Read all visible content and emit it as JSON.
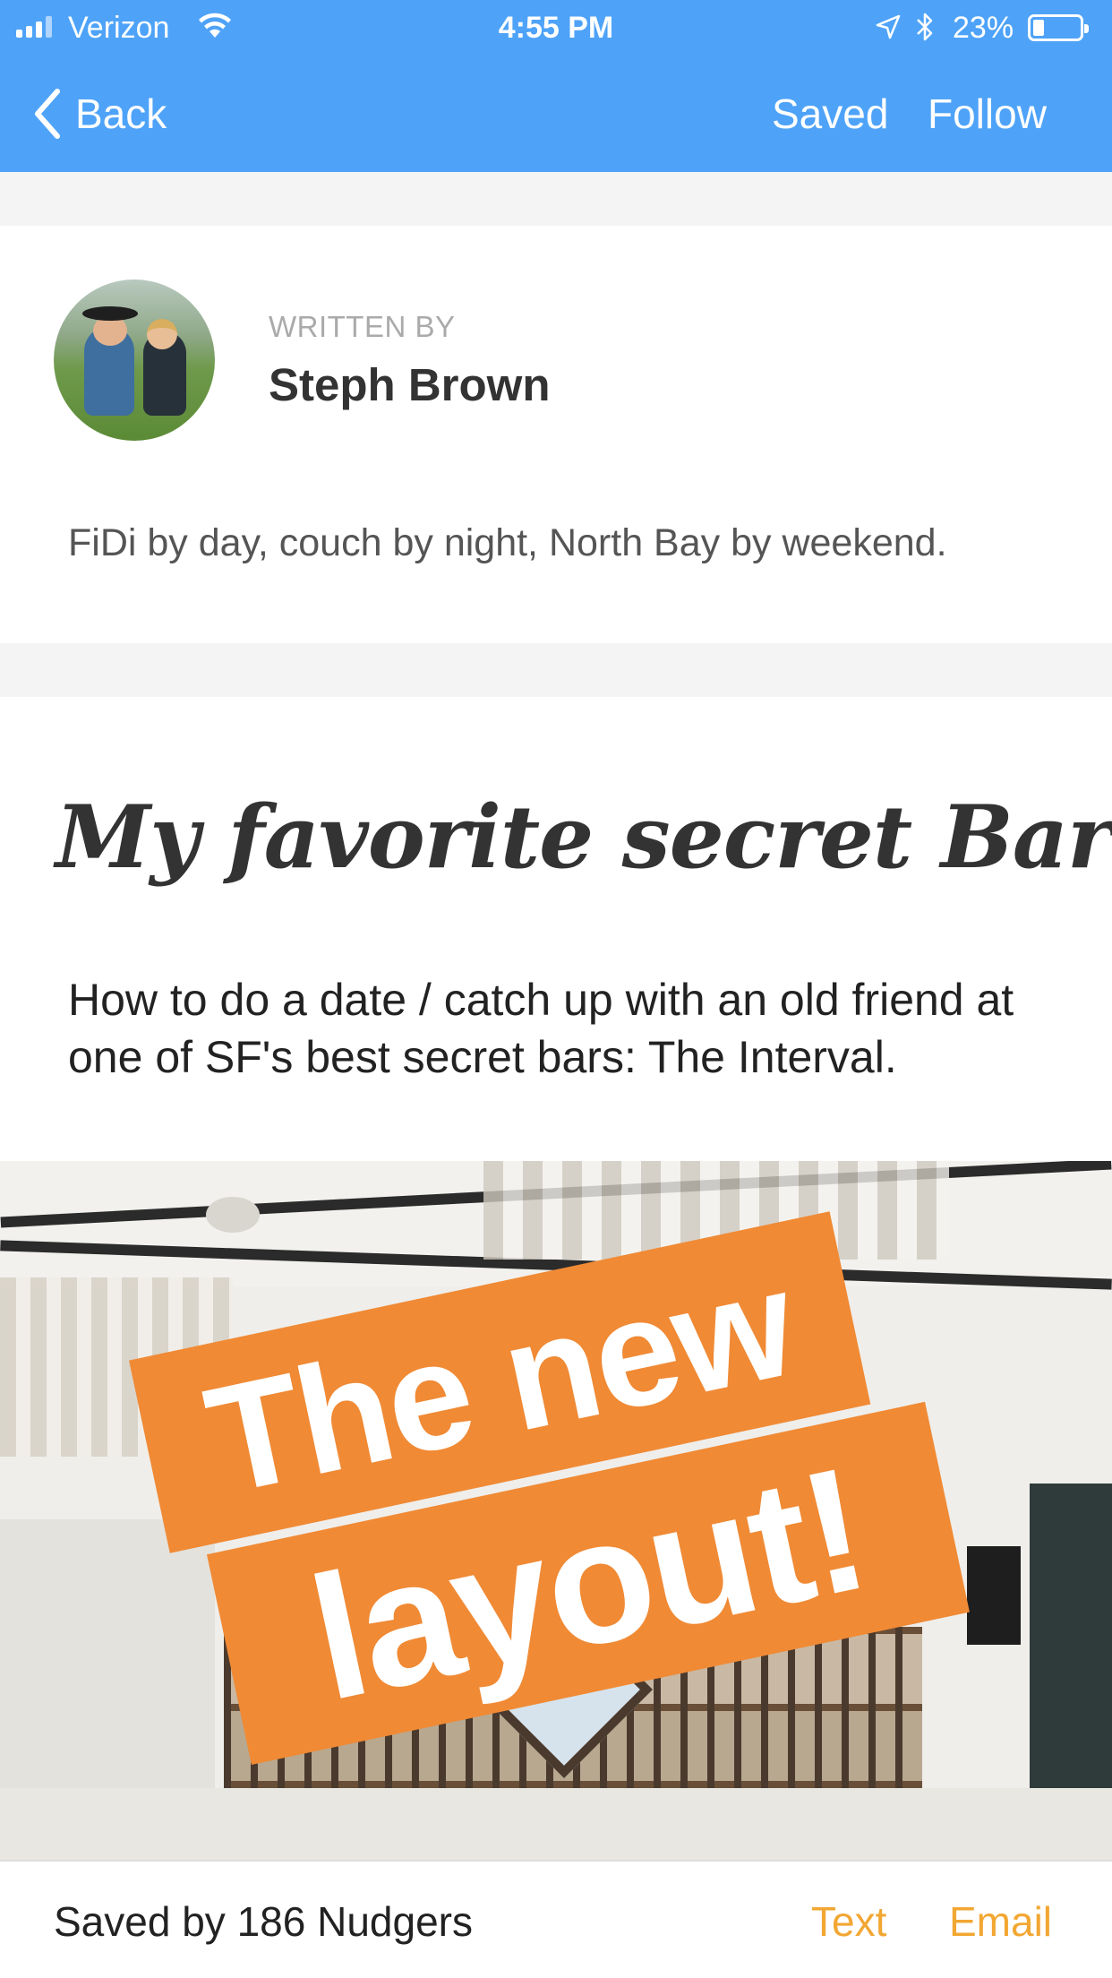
{
  "status_bar": {
    "carrier": "Verizon",
    "time": "4:55 PM",
    "battery_percent": "23%",
    "battery_level": 0.23,
    "icons": [
      "signal-icon",
      "wifi-icon",
      "location-icon",
      "bluetooth-icon",
      "battery-icon"
    ]
  },
  "nav": {
    "back_label": "Back",
    "saved_label": "Saved",
    "follow_label": "Follow",
    "background_color": "#4ea3f8"
  },
  "author": {
    "written_by_label": "WRITTEN BY",
    "name": "Steph Brown",
    "bio": "FiDi by day, couch by night, North Bay by weekend."
  },
  "article": {
    "title": "My favorite secret Bar",
    "summary": "How to do a date / catch up with an old friend at one of SF's best secret bars: The Interval.",
    "hero_banner": {
      "line1": "The new",
      "line2": "layout!",
      "color": "#f08a35"
    }
  },
  "footer": {
    "saved_count_text": "Saved by 186 Nudgers",
    "share_text_label": "Text",
    "share_email_label": "Email",
    "accent_color": "#f2a733"
  }
}
